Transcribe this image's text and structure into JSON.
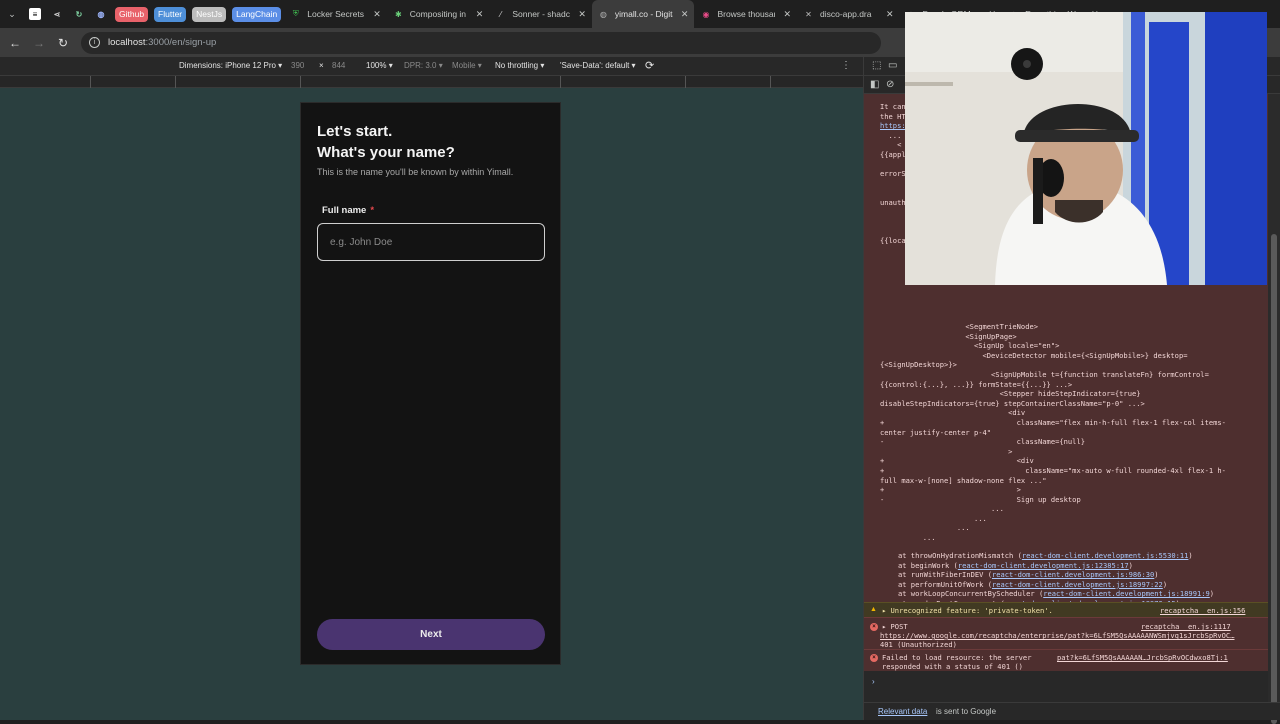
{
  "tabs": {
    "bookmarks": [
      {
        "label": "Github",
        "bg": "#e8626a"
      },
      {
        "label": "Flutter",
        "bg": "#4e8fd8"
      },
      {
        "label": "NestJs",
        "bg": "#bcbcbc"
      },
      {
        "label": "LangChain",
        "bg": "#5b8ee6"
      }
    ],
    "items": [
      {
        "title": "Locker Secrets",
        "icon": "shield-icon"
      },
      {
        "title": "Compositing in",
        "icon": "gear-icon"
      },
      {
        "title": "Sonner - shadcn",
        "icon": "slash-icon"
      },
      {
        "title": "yimall.co - Digital",
        "icon": "globe-icon",
        "active": true
      },
      {
        "title": "Browse thousand",
        "icon": "dribbble-icon"
      },
      {
        "title": "disco-app.dra",
        "icon": "close-icon"
      },
      {
        "title": "Dazzle ORM",
        "icon": "globe-icon"
      },
      {
        "title": "Everything W",
        "icon": "globe-icon"
      }
    ]
  },
  "address": {
    "host": "localhost",
    "path": ":3000/en/sign-up"
  },
  "device_toolbar": {
    "dimensions_label": "Dimensions: iPhone 12 Pro",
    "width": "390",
    "times": "×",
    "height": "844",
    "zoom": "100%",
    "dpr": "DPR: 3.0",
    "mode": "Mobile",
    "throttling": "No throttling",
    "save_data": "'Save-Data': default"
  },
  "signup": {
    "heading_line1": "Let's start.",
    "heading_line2": "What's your name?",
    "subtitle": "This is the name you'll be known by within Yimall.",
    "field_label": "Full name",
    "required_mark": "*",
    "placeholder": "e.g. John Doe",
    "next_label": "Next"
  },
  "console": {
    "partial_lines": [
      "It can",
      "the HTML",
      "https:",
      "  ...",
      "    <",
      "{{appl",
      "",
      "errorS",
      "",
      "",
      "unauth",
      "",
      "",
      "",
      "{{loca"
    ],
    "tree_lines": [
      "                    <SegmentTrieNode>",
      "                    <SignUpPage>",
      "                      <SignUp locale=\"en\">",
      "                        <DeviceDetector mobile={<SignUpMobile>} desktop=",
      "{<SignUpDesktop>}>",
      "                          <SignUpMobile t={function translateFn} formControl=",
      "{{control:{...}, ...}} formState={{...}} ...>",
      "                            <Stepper hideStepIndicator={true}",
      "disableStepIndicators={true} stepContainerClassName=\"p-0\" ...>",
      "                              <div",
      "+                               className=\"flex min-h-full flex-1 flex-col items-",
      "center justify-center p-4\"",
      "-                               className={null}",
      "                              >",
      "+                               <div",
      "+                                 className=\"mx-auto w-full rounded-4xl flex-1 h-",
      "full max-w-[none] shadow-none flex ...\"",
      "+                               >",
      "-                               Sign up desktop",
      "                          ...",
      "                      ...",
      "                  ...",
      "          ..."
    ],
    "stack": [
      {
        "fn": "at throwOnHydrationMismatch",
        "src": "react-dom-client.development.js:5530:11"
      },
      {
        "fn": "at beginWork",
        "src": "react-dom-client.development.js:12385:17"
      },
      {
        "fn": "at runWithFiberInDEV",
        "src": "react-dom-client.development.js:986:30"
      },
      {
        "fn": "at performUnitOfWork",
        "src": "react-dom-client.development.js:18997:22"
      },
      {
        "fn": "at workLoopConcurrentByScheduler",
        "src": "react-dom-client.development.js:18991:9"
      },
      {
        "fn": "at renderRootConcurrent",
        "src": "react-dom-client.development.js:18973:15"
      },
      {
        "fn": "at performWorkOnRoot",
        "src": "react-dom-client.development.js:17834:11"
      },
      {
        "fn": "at performWorkOnRootViaSchedulerTask",
        "src": "react-dom-client.development.js:20384:7"
      },
      {
        "fn": "at MessagePort.performWorkUntilDeadline",
        "src": "scheduler.development.js:45:48"
      }
    ],
    "warning": {
      "text": "▸ Unrecognized feature: 'private-token'.",
      "src": "recaptcha__en.js:156"
    },
    "error_post": {
      "label": "▸ POST",
      "src": "recaptcha__en.js:1117",
      "url": "https://www.google.com/recaptcha/enterprise/pat?k=6LfSM5QsAAAAANWSmjvq1sJrcbSpRvOC…",
      "status": "401 (Unauthorized)"
    },
    "error_load": {
      "line1": "Failed to load resource: the server",
      "line2": "responded with a status of 401 ()",
      "src": "pat?k=6LfSM5QsAAAAAN…JrcbSpRvOCdwxo8Tj:1"
    },
    "prompt": "›"
  },
  "footer": {
    "link": "Relevant data",
    "text": "is sent to Google"
  },
  "colors": {
    "viewport_bg": "#2a3f3f",
    "card_bg": "#131313",
    "button_bg": "#4a3470",
    "error_bg": "#4e2f2f",
    "link": "#a8c7fa"
  }
}
